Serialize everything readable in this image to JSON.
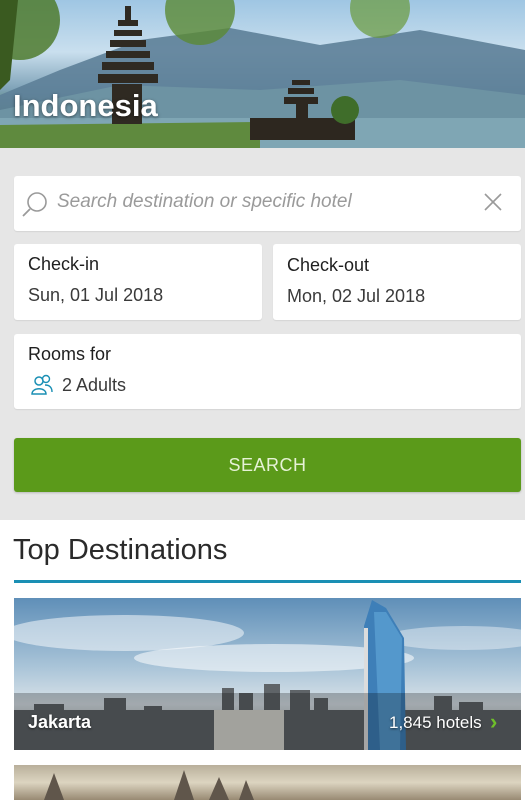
{
  "hero": {
    "title": "Indonesia"
  },
  "search": {
    "placeholder": "Search destination or specific hotel"
  },
  "checkin": {
    "label": "Check-in",
    "value": "Sun, 01 Jul 2018"
  },
  "checkout": {
    "label": "Check-out",
    "value": "Mon, 02 Jul 2018"
  },
  "rooms": {
    "label": "Rooms for",
    "value": "2 Adults"
  },
  "search_button": {
    "label": "SEARCH"
  },
  "top_destinations": {
    "heading": "Top Destinations",
    "items": [
      {
        "name": "Jakarta",
        "count": "1,845 hotels"
      }
    ]
  },
  "colors": {
    "accent_green": "#5b9a1a",
    "divider_blue": "#1a8fb4",
    "icon_teal": "#1a8fb4"
  },
  "icons": [
    "search-icon",
    "close-icon",
    "people-icon",
    "chevron-right-icon"
  ]
}
